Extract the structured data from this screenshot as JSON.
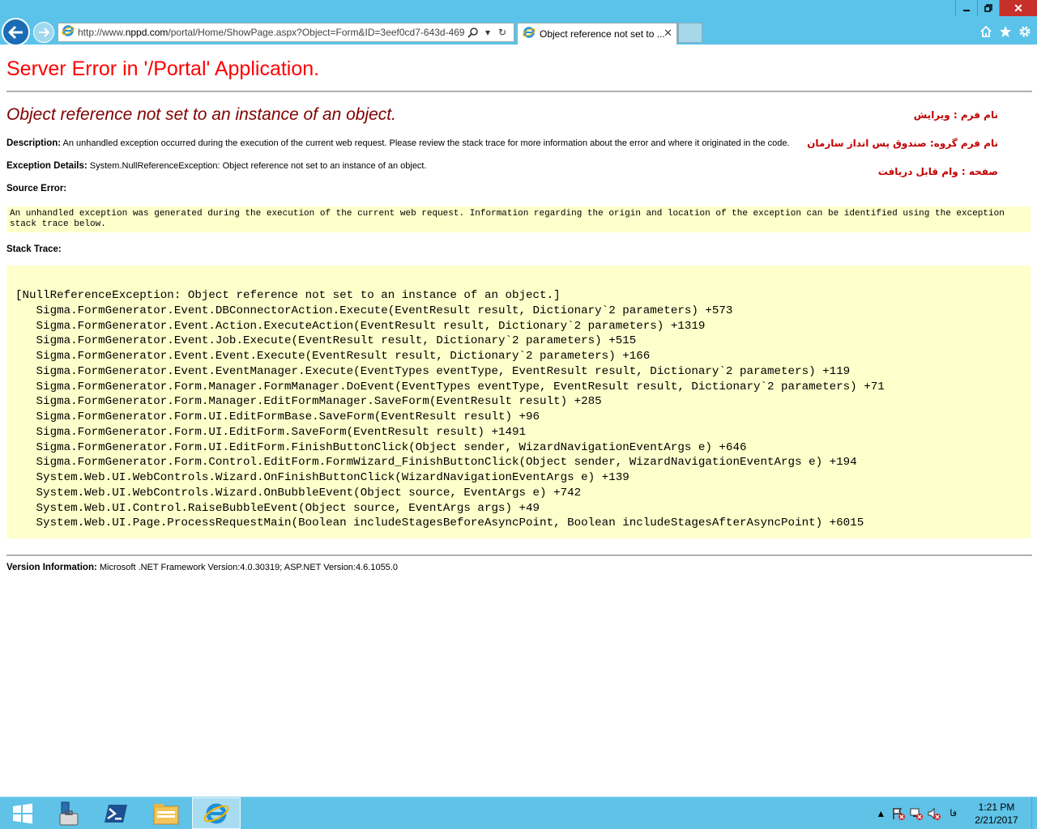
{
  "browser": {
    "url_prefix": "http://www.",
    "url_domain": "nppd.com",
    "url_rest": "/portal/Home/ShowPage.aspx?Object=Form&ID=3eef0cd7-643d-469",
    "tab_title": "Object reference not set to ...",
    "window_controls": [
      "minimize-icon",
      "restore-icon",
      "close-icon"
    ],
    "toolbar_icons": [
      "home-icon",
      "favorites-star-icon",
      "settings-gear-icon"
    ]
  },
  "page": {
    "heading": "Server Error in '/Portal' Application.",
    "error_title": "Object reference not set to an instance of an object.",
    "description_label": "Description:",
    "description_text": "An unhandled exception occurred during the execution of the current web request. Please review the stack trace for more information about the error and where it originated in the code.",
    "exception_label": "Exception Details:",
    "exception_text": "System.NullReferenceException: Object reference not set to an instance of an object.",
    "source_error_label": "Source Error:",
    "source_error_text": "An unhandled exception was generated during the execution of the current web request. Information regarding the origin and location of the exception can be identified using the exception stack trace below.",
    "stack_trace_label": "Stack Trace:",
    "stack_trace": [
      "[NullReferenceException: Object reference not set to an instance of an object.]",
      "   Sigma.FormGenerator.Event.DBConnectorAction.Execute(EventResult result, Dictionary`2 parameters) +573",
      "   Sigma.FormGenerator.Event.Action.ExecuteAction(EventResult result, Dictionary`2 parameters) +1319",
      "   Sigma.FormGenerator.Event.Job.Execute(EventResult result, Dictionary`2 parameters) +515",
      "   Sigma.FormGenerator.Event.Event.Execute(EventResult result, Dictionary`2 parameters) +166",
      "   Sigma.FormGenerator.Event.EventManager.Execute(EventTypes eventType, EventResult result, Dictionary`2 parameters) +119",
      "   Sigma.FormGenerator.Form.Manager.FormManager.DoEvent(EventTypes eventType, EventResult result, Dictionary`2 parameters) +71",
      "   Sigma.FormGenerator.Form.Manager.EditFormManager.SaveForm(EventResult result) +285",
      "   Sigma.FormGenerator.Form.UI.EditFormBase.SaveForm(EventResult result) +96",
      "   Sigma.FormGenerator.Form.UI.EditForm.SaveForm(EventResult result) +1491",
      "   Sigma.FormGenerator.Form.UI.EditForm.FinishButtonClick(Object sender, WizardNavigationEventArgs e) +646",
      "   Sigma.FormGenerator.Form.Control.EditForm.FormWizard_FinishButtonClick(Object sender, WizardNavigationEventArgs e) +194",
      "   System.Web.UI.WebControls.Wizard.OnFinishButtonClick(WizardNavigationEventArgs e) +139",
      "   System.Web.UI.WebControls.Wizard.OnBubbleEvent(Object source, EventArgs e) +742",
      "   System.Web.UI.Control.RaiseBubbleEvent(Object source, EventArgs args) +49",
      "   System.Web.UI.Page.ProcessRequestMain(Boolean includeStagesBeforeAsyncPoint, Boolean includeStagesAfterAsyncPoint) +6015"
    ],
    "version_label": "Version Information:",
    "version_text": "Microsoft .NET Framework Version:4.0.30319; ASP.NET Version:4.6.1055.0",
    "rtl_info": {
      "form_name": "نام فرم : ویرایش",
      "form_group": "نام فرم گروه: صندوق پس انداز سازمان",
      "page": "صفحه : وام قابل دریافت"
    }
  },
  "taskbar": {
    "apps": [
      "start-icon",
      "server-manager-icon",
      "powershell-icon",
      "file-explorer-icon",
      "internet-explorer-icon"
    ],
    "language": "فا",
    "time": "1:21 PM",
    "date": "2/21/2017"
  },
  "colors": {
    "chrome_bg": "#5bc3ea",
    "heading_red": "#ff0000",
    "title_maroon": "#800000",
    "code_bg": "#ffffcc",
    "rtl_red": "#c00000",
    "taskbar_bg": "#5fc2e6"
  }
}
